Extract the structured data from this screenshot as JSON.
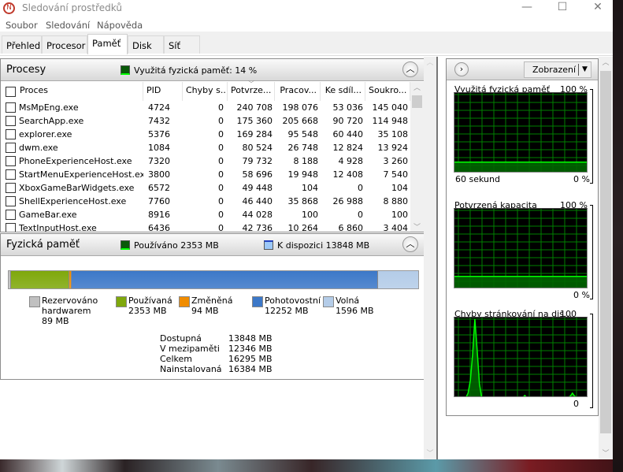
{
  "window": {
    "title": "Sledování prostředků",
    "controls": [
      "minimize",
      "maximize",
      "close"
    ]
  },
  "menu": [
    "Soubor",
    "Sledování",
    "Nápověda"
  ],
  "tabs": [
    {
      "label": "Přehled"
    },
    {
      "label": "Procesor"
    },
    {
      "label": "Paměť",
      "selected": true
    },
    {
      "label": "Disk"
    },
    {
      "label": "Síť"
    }
  ],
  "processes": {
    "title": "Procesy",
    "indicator": "Využitá fyzická paměť: 14 %",
    "columns": [
      "Proces",
      "PID",
      "Chyby s...",
      "Potvrze...",
      "Pracov...",
      "Ke sdíl...",
      "Soukro..."
    ],
    "sorted_column": "Potvrze...",
    "rows": [
      [
        "MsMpEng.exe",
        "4724",
        "0",
        "240 708",
        "198 076",
        "53 036",
        "145 040"
      ],
      [
        "SearchApp.exe",
        "7432",
        "0",
        "175 360",
        "205 668",
        "90 720",
        "114 948"
      ],
      [
        "explorer.exe",
        "5376",
        "0",
        "169 284",
        "95 548",
        "60 440",
        "35 108"
      ],
      [
        "dwm.exe",
        "1084",
        "0",
        "80 524",
        "26 748",
        "12 824",
        "13 924"
      ],
      [
        "PhoneExperienceHost.exe",
        "7320",
        "0",
        "79 732",
        "8 188",
        "4 928",
        "3 260"
      ],
      [
        "StartMenuExperienceHost.exe",
        "3800",
        "0",
        "58 696",
        "19 948",
        "12 408",
        "7 540"
      ],
      [
        "XboxGameBarWidgets.exe",
        "6572",
        "0",
        "49 448",
        "104",
        "0",
        "104"
      ],
      [
        "ShellExperienceHost.exe",
        "7760",
        "0",
        "46 440",
        "35 868",
        "26 988",
        "8 880"
      ],
      [
        "GameBar.exe",
        "8916",
        "0",
        "44 028",
        "100",
        "0",
        "100"
      ],
      [
        "TextInputHost.exe",
        "6436",
        "0",
        "42 736",
        "10 264",
        "6 860",
        "3 404"
      ]
    ]
  },
  "physical": {
    "title": "Fyzická paměť",
    "used_label": "Používáno 2353 MB",
    "avail_label": "K dispozici 13848 MB",
    "segments": [
      {
        "name": "Rezervováno hardwarem",
        "value_mb": 89,
        "color": "#c0c0c0",
        "l1": "Rezervováno",
        "l2": "hardwarem",
        "l3": "89 MB"
      },
      {
        "name": "Používaná",
        "value_mb": 2353,
        "color": "#7fa80c",
        "l1": "Používaná",
        "l2": "2353 MB"
      },
      {
        "name": "Změněná",
        "value_mb": 94,
        "color": "#f08c00",
        "l1": "Změněná",
        "l2": "94 MB"
      },
      {
        "name": "Pohotovostní",
        "value_mb": 12252,
        "color": "#3c78c8",
        "l1": "Pohotovostní",
        "l2": "12252 MB"
      },
      {
        "name": "Volná",
        "value_mb": 1596,
        "color": "#b4cce8",
        "l1": "Volná",
        "l2": "1596 MB"
      }
    ],
    "stats": [
      [
        "Dostupná",
        "13848 MB"
      ],
      [
        "V mezipaměti",
        "12346 MB"
      ],
      [
        "Celkem",
        "16295 MB"
      ],
      [
        "Nainstalovaná",
        "16384 MB"
      ]
    ]
  },
  "right": {
    "view_button": "Zobrazení",
    "graphs": [
      {
        "label": "Využitá fyzická paměť",
        "max": "100 %",
        "min": "0 %",
        "xlabel": "60 sekund",
        "values": [
          14,
          14,
          14,
          14,
          14,
          14,
          14,
          14,
          14,
          14,
          14,
          14,
          14,
          14,
          14,
          14,
          14,
          14,
          14,
          14,
          14,
          14,
          14,
          14,
          14,
          14,
          14,
          14,
          14,
          14,
          14,
          14,
          14,
          14,
          14,
          14,
          14,
          14,
          14,
          14,
          14,
          14,
          14,
          14,
          14,
          14,
          14,
          14,
          14,
          14,
          14,
          14,
          14,
          14,
          14,
          14,
          14,
          14,
          14,
          14
        ]
      },
      {
        "label": "Potvrzená kapacita",
        "max": "100 %",
        "min": "0 %",
        "values": [
          16,
          16,
          16,
          16,
          16,
          16,
          16,
          16,
          16,
          16,
          16,
          16,
          16,
          16,
          16,
          16,
          16,
          16,
          16,
          16,
          16,
          16,
          16,
          16,
          16,
          16,
          16,
          16,
          16,
          16,
          16,
          16,
          16,
          16,
          16,
          16,
          16,
          16,
          16,
          16,
          16,
          16,
          16,
          16,
          16,
          16,
          16,
          16,
          16,
          16,
          16,
          16,
          16,
          16,
          16,
          16,
          16,
          16,
          16,
          16
        ]
      },
      {
        "label": "Chyby stránkování na dis...",
        "max": "100",
        "min": "0",
        "values": [
          0,
          0,
          0,
          0,
          0,
          0,
          6,
          22,
          55,
          98,
          60,
          18,
          0,
          1,
          1,
          0,
          1,
          1,
          0,
          1,
          0,
          1,
          1,
          0,
          0,
          0,
          0,
          0,
          0,
          0,
          0,
          3,
          0,
          0,
          0,
          0,
          0,
          0,
          0,
          0,
          0,
          0,
          0,
          0,
          0,
          0,
          0,
          0,
          0,
          0,
          1,
          2,
          6,
          2,
          1,
          0,
          0,
          0,
          0,
          0
        ]
      }
    ]
  },
  "colors": {
    "graph_bg": "#000000",
    "graph_grid": "#008000",
    "graph_line": "#00ff00",
    "graph_fill": "#006400"
  }
}
